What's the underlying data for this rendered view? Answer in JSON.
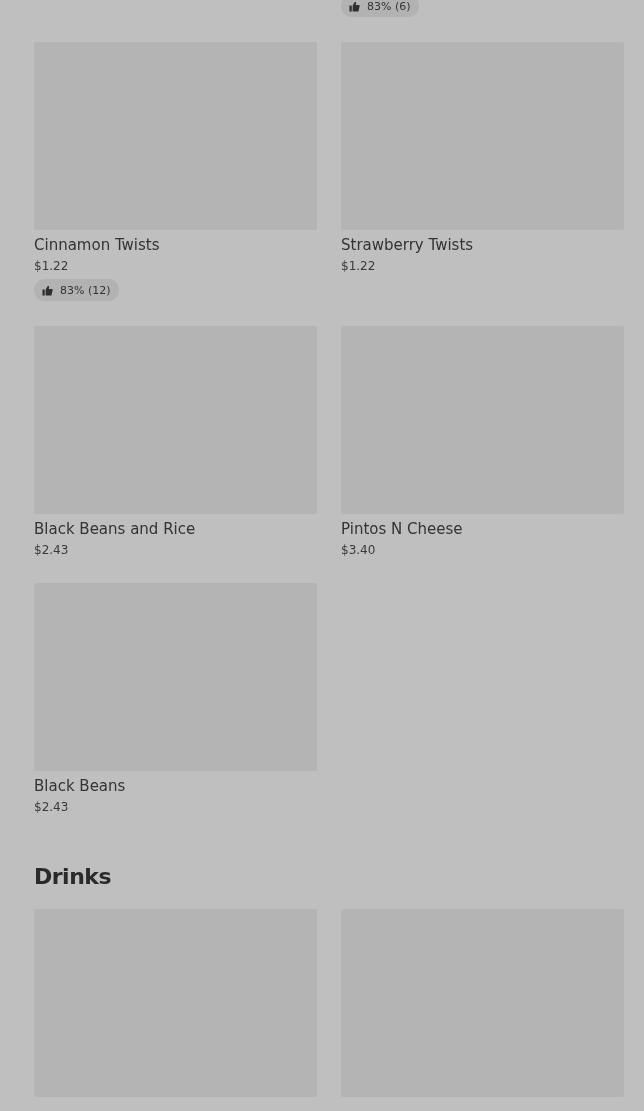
{
  "sections": [
    {
      "items": [
        {
          "kind": "cut"
        },
        {
          "kind": "cut",
          "rating": "83% (6)"
        },
        {
          "kind": "card",
          "name": "Cinnamon Twists",
          "price": "$1.22",
          "rating": "83% (12)"
        },
        {
          "kind": "card",
          "name": "Strawberry Twists",
          "price": "$1.22"
        },
        {
          "kind": "card",
          "name": "Black Beans and Rice",
          "price": "$2.43"
        },
        {
          "kind": "card",
          "name": "Pintos N Cheese",
          "price": "$3.40"
        },
        {
          "kind": "card",
          "name": "Black Beans",
          "price": "$2.43"
        }
      ]
    },
    {
      "title": "Drinks",
      "items": [
        {
          "kind": "image-only"
        },
        {
          "kind": "image-only"
        }
      ]
    }
  ]
}
